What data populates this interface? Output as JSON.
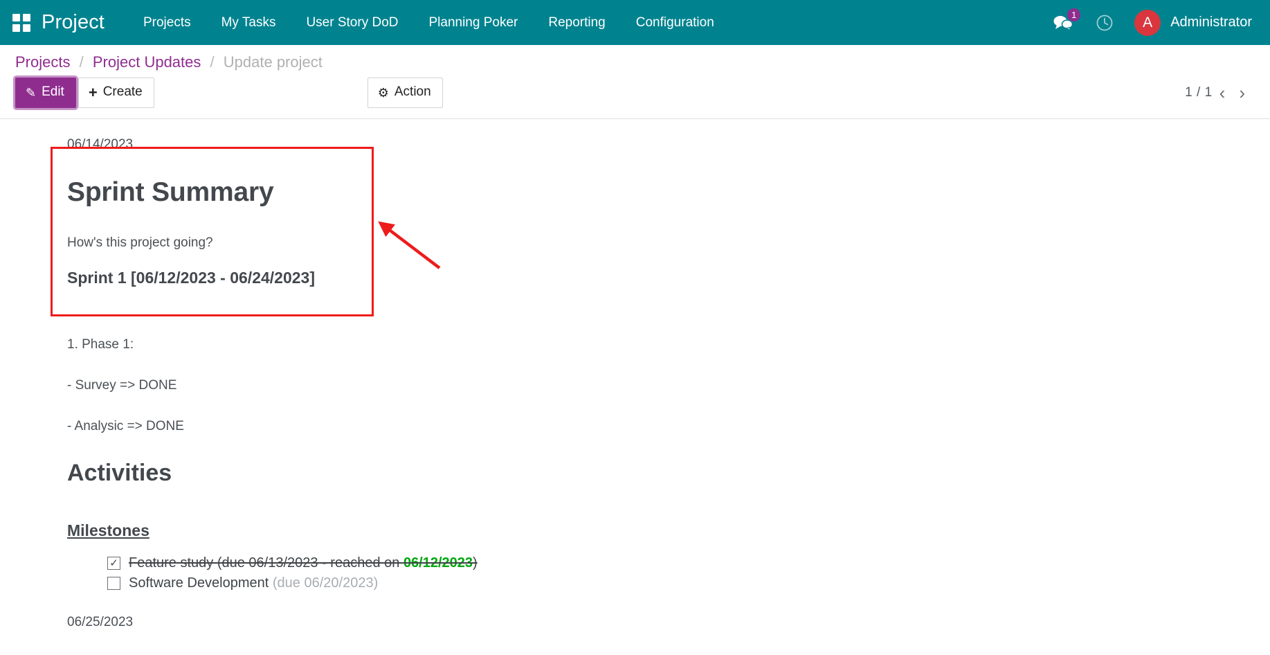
{
  "navbar": {
    "apps_icon": "apps-grid-icon",
    "brand": "Project",
    "menu": [
      {
        "label": "Projects"
      },
      {
        "label": "My Tasks"
      },
      {
        "label": "User Story DoD"
      },
      {
        "label": "Planning Poker"
      },
      {
        "label": "Reporting"
      },
      {
        "label": "Configuration"
      }
    ],
    "messages_icon": "chat-bubbles-icon",
    "messages_badge": "1",
    "activities_icon": "clock-icon",
    "avatar_initial": "A",
    "user_name": "Administrator",
    "accent_color": "#00838f",
    "badge_color": "#8f2d8f",
    "avatar_color": "#d9363e"
  },
  "control_panel": {
    "breadcrumb": {
      "items": [
        {
          "label": "Projects",
          "current": false
        },
        {
          "label": "Project Updates",
          "current": false
        },
        {
          "label": "Update project",
          "current": true
        }
      ],
      "separator": "/"
    },
    "buttons": {
      "edit_label": "Edit",
      "edit_icon": "pencil-icon",
      "create_label": "Create",
      "create_icon": "plus-icon",
      "action_label": "Action",
      "action_icon": "gear-icon"
    },
    "pager": {
      "value": "1 / 1",
      "prev_icon": "chevron-left-icon",
      "next_icon": "chevron-right-icon"
    }
  },
  "update": {
    "date": "06/14/2023",
    "title": "Sprint Summary",
    "question": "How's this project going?",
    "sprint_line": "Sprint 1 [06/12/2023 - 06/24/2023]",
    "phase_heading": "1. Phase 1:",
    "phase_items": [
      "- Survey => DONE",
      "- Analysic => DONE"
    ],
    "activities_title": "Activities",
    "milestones_title": "Milestones",
    "milestones": [
      {
        "checked": true,
        "checkbox_glyph": "✓",
        "text": "Feature study (due 06/13/2023 - reached on ",
        "reached_date": "06/12/2023",
        "suffix": ")",
        "due_text": ""
      },
      {
        "checked": false,
        "checkbox_glyph": "",
        "text": "Software Development ",
        "reached_date": "",
        "suffix": "",
        "due_text": "(due 06/20/2023)"
      }
    ],
    "bottom_date": "06/25/2023"
  },
  "annotation": {
    "box_color": "#ee1b1b",
    "arrow_color": "#ee1b1b"
  }
}
